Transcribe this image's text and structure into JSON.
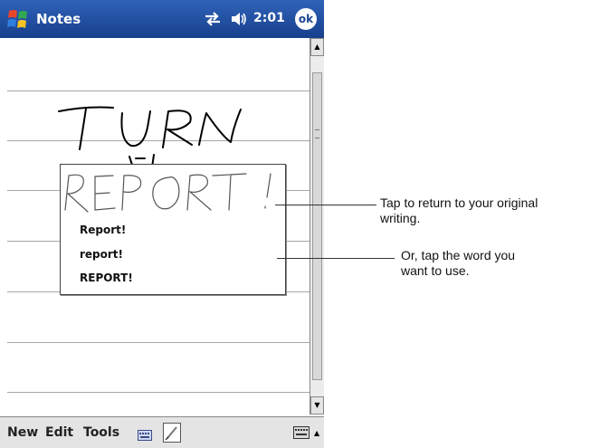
{
  "titlebar": {
    "app_title": "Notes",
    "time": "2:01",
    "ok_label": "ok",
    "accent": "#1f4fa3"
  },
  "icons": {
    "start": "windows-flag-icon",
    "connectivity": "connectivity-arrows-icon",
    "volume": "speaker-icon",
    "keyboard": "keyboard-icon",
    "pen": "pen-icon"
  },
  "alternates": {
    "items": [
      "Report!",
      "report!",
      "REPORT!"
    ]
  },
  "menubar": {
    "new": "New",
    "edit": "Edit",
    "tools": "Tools"
  },
  "callouts": {
    "first_line1": "Tap to return to your original",
    "first_line2": "writing.",
    "second_line1": "Or, tap the word you",
    "second_line2": "want to use."
  }
}
